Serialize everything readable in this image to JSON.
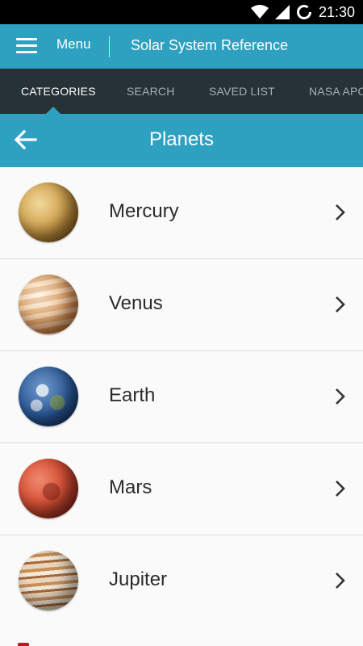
{
  "status_bar": {
    "time": "21:30"
  },
  "app_bar": {
    "menu_label": "Menu",
    "title": "Solar System Reference"
  },
  "tabs": [
    {
      "label": "CATEGORIES",
      "active": true
    },
    {
      "label": "SEARCH",
      "active": false
    },
    {
      "label": "SAVED LIST",
      "active": false
    },
    {
      "label": "NASA APOD",
      "active": false
    }
  ],
  "header": {
    "title": "Planets"
  },
  "planets": [
    {
      "name": "Mercury",
      "icon": "mercury-icon"
    },
    {
      "name": "Venus",
      "icon": "venus-icon"
    },
    {
      "name": "Earth",
      "icon": "earth-icon"
    },
    {
      "name": "Mars",
      "icon": "mars-icon"
    },
    {
      "name": "Jupiter",
      "icon": "jupiter-icon"
    }
  ],
  "colors": {
    "primary": "#2ea0c0",
    "tab_bar": "#263238",
    "background": "#fafafa",
    "status_bar": "#000000"
  }
}
